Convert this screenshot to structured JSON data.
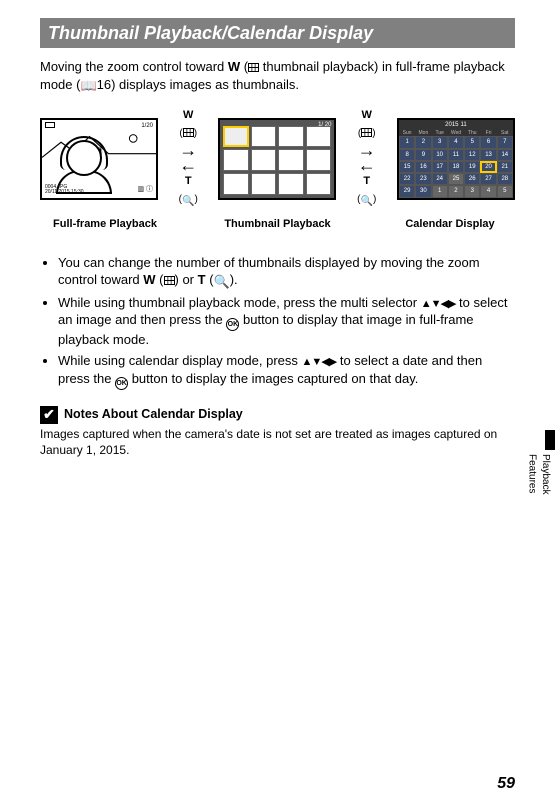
{
  "heading": "Thumbnail Playback/Calendar Display",
  "intro_part1": "Moving the zoom control toward ",
  "intro_W": "W",
  "intro_part2": " thumbnail playback) in full-frame playback mode (",
  "intro_ref": "16) displays images as thumbnails.",
  "wt": {
    "W": "W",
    "T": "T"
  },
  "captions": {
    "full": "Full-frame Playback",
    "thumb": "Thumbnail Playback",
    "cal": "Calendar Display"
  },
  "full_frame": {
    "top_right": "1/20",
    "info_line1": "0004.JPG",
    "info_line2": "20/11/2015  15:30"
  },
  "thumb_screen": {
    "indicator": "1/ 20"
  },
  "calendar": {
    "year": "2015",
    "month": "11",
    "dow": [
      "Sun",
      "Mon",
      "Tue",
      "Wed",
      "Thu",
      "Fri",
      "Sat"
    ],
    "days": [
      [
        "1",
        "2",
        "3",
        "4",
        "5",
        "6",
        "7"
      ],
      [
        "8",
        "9",
        "10",
        "11",
        "12",
        "13",
        "14"
      ],
      [
        "15",
        "16",
        "17",
        "18",
        "19",
        "20",
        "21"
      ],
      [
        "22",
        "23",
        "24",
        "25",
        "26",
        "27",
        "28"
      ],
      [
        "29",
        "30",
        "",
        "",
        "",
        "",
        ""
      ]
    ],
    "grey_cols_first_row": [],
    "selected": "20",
    "trailing_next_month": [
      "1",
      "2",
      "3",
      "4",
      "5"
    ]
  },
  "bullets": {
    "b1a": "You can change the number of thumbnails displayed by moving the zoom control toward ",
    "b1b": ") or ",
    "b1c": ").",
    "T": "T",
    "b2a": "While using thumbnail playback mode, press the multi selector ",
    "b2b": " to select an image and then press the ",
    "b2c": " button to display that image in full-frame playback mode.",
    "b3a": "While using calendar display mode, press ",
    "b3b": " to select a date and then press the ",
    "b3c": " button to display the images captured on that day."
  },
  "note": {
    "title": "Notes About Calendar Display",
    "body": "Images captured when the camera's date is not set are treated as images captured on January 1, 2015."
  },
  "side_tab": "Playback Features",
  "page_number": "59"
}
